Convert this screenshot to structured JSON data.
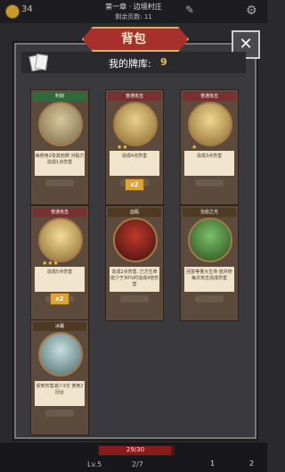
{
  "topbar": {
    "coins": "34",
    "chapter": "第一章 · 边境村庄",
    "pages_left": "剩余页数: 11"
  },
  "bag": {
    "title": "背包",
    "close_label": "✕",
    "deck_label": "我的牌库:",
    "deck_count": "9"
  },
  "cards": [
    {
      "name": "利剑",
      "theme": "green",
      "desc": "每使用2张其他牌\n对敌方造成1点伤害",
      "stars": "",
      "foot": "",
      "multiplier": ""
    },
    {
      "name": "普通攻击",
      "theme": "red",
      "desc": "造成4点伤害",
      "stars": "★★",
      "foot": "",
      "multiplier": "x2"
    },
    {
      "name": "普通攻击",
      "theme": "red",
      "desc": "造成3点伤害",
      "stars": "★",
      "foot": "",
      "multiplier": ""
    },
    {
      "name": "普通攻击",
      "theme": "red",
      "desc": "造成5点伤害",
      "stars": "★★★",
      "foot": "",
      "multiplier": "x2"
    },
    {
      "name": "血瓶",
      "theme": "gold",
      "desc": "造成2点伤害, 己方生命\n值少于30%时造成4倍伤害",
      "stars": "",
      "foot": "",
      "multiplier": ""
    },
    {
      "name": "治愈之光",
      "theme": "gold",
      "desc": "回复等量大生命\n值并使每次攻击造成伤害",
      "stars": "",
      "foot": "",
      "multiplier": ""
    },
    {
      "name": "冰霜",
      "theme": "gold",
      "desc": "受到伤害减少3次\n使用2回合",
      "stars": "",
      "foot": "",
      "multiplier": ""
    }
  ],
  "player": {
    "hp_text": "29/30",
    "hp_fraction": 0.97,
    "level": "Lv.5",
    "xp": "2/7",
    "count_a": "1",
    "count_b": "2"
  }
}
